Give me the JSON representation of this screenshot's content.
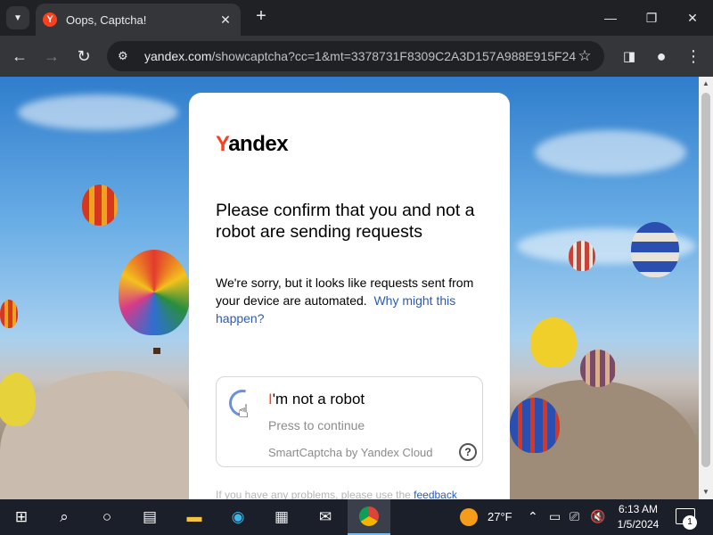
{
  "browser": {
    "tab_title": "Oops, Captcha!",
    "favicon_letter": "Y",
    "url_host": "yandex.com",
    "url_rest": "/showcaptcha?cc=1&mt=3378731F8309C2A3D157A988E915F24..."
  },
  "page": {
    "logo_first": "Y",
    "logo_rest": "andex",
    "heading": "Please confirm that you and not a robot are sending requests",
    "description": "We're sorry, but it looks like requests sent from your device are automated.",
    "why_link": "Why might this happen?",
    "captcha": {
      "title_first": "I",
      "title_rest": "'m not a robot",
      "subtitle": "Press to continue",
      "brand": "SmartCaptcha by Yandex Cloud",
      "help": "?"
    },
    "feedback_text": "If you have any problems, please use the",
    "feedback_link": "feedback"
  },
  "taskbar": {
    "temperature": "27°F",
    "time": "6:13 AM",
    "date": "1/5/2024",
    "notification_count": "1"
  },
  "colors": {
    "yandex_red": "#fc3f1d",
    "link_blue": "#2a5bb6"
  }
}
